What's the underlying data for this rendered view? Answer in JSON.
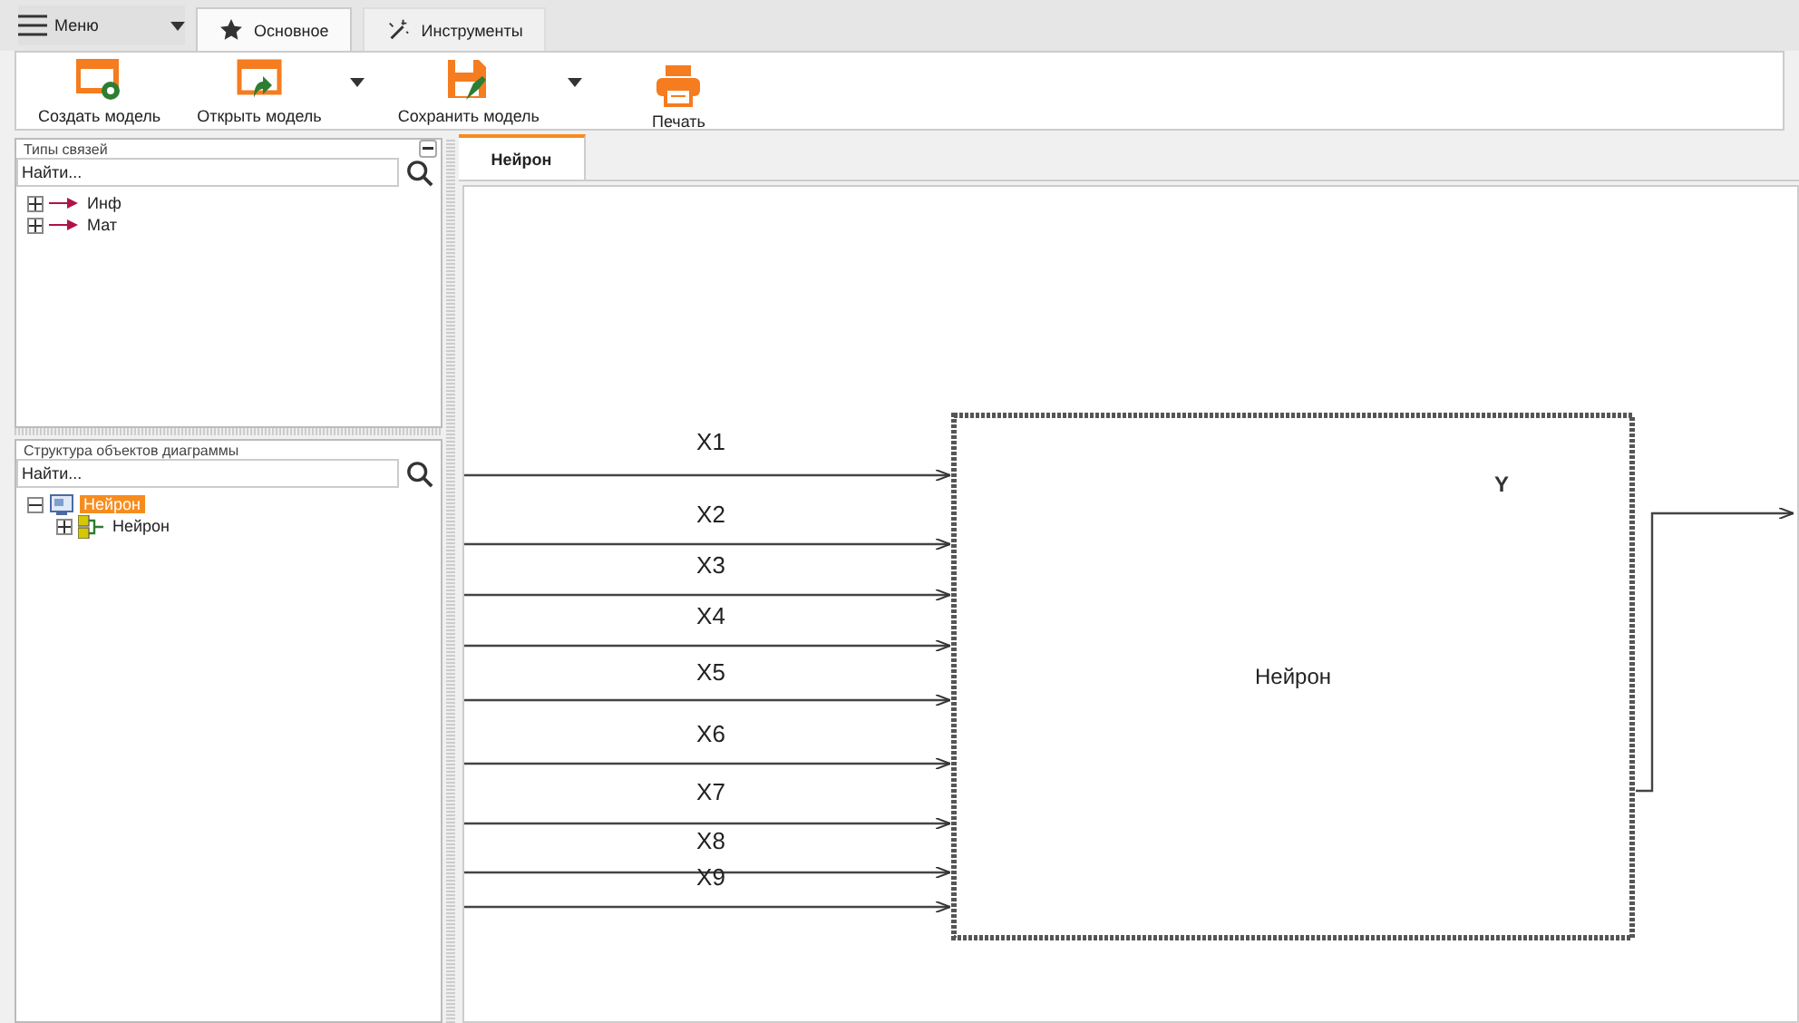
{
  "menu": {
    "label": "Меню"
  },
  "tabs": [
    {
      "label": "Основное",
      "kind": "star",
      "selected": true
    },
    {
      "label": "Инструменты",
      "kind": "wand",
      "selected": false
    }
  ],
  "ribbon": {
    "buttons": [
      {
        "label": "Создать модель",
        "kind": "create",
        "dropdown": false
      },
      {
        "label": "Открыть модель",
        "kind": "open",
        "dropdown": true
      },
      {
        "label": "Сохранить модель",
        "kind": "save",
        "dropdown": true
      },
      {
        "label": "Печать",
        "kind": "print",
        "dropdown": false
      }
    ]
  },
  "link_types": {
    "title": "Типы связей",
    "search": {
      "placeholder": "Найти..."
    },
    "items": [
      {
        "label": "Инф",
        "expanded": false
      },
      {
        "label": "Мат",
        "expanded": false
      }
    ]
  },
  "structure": {
    "title": "Структура объектов диаграммы",
    "search": {
      "placeholder": "Найти..."
    },
    "items": [
      {
        "label": "Нейрон",
        "expanded": true,
        "selected": true,
        "children": [
          {
            "label": "Нейрон",
            "expanded": false,
            "selected": false
          }
        ]
      }
    ]
  },
  "document_tabs": [
    {
      "label": "Нейрон",
      "selected": true
    }
  ],
  "diagram": {
    "node": "Нейрон",
    "output": "Y",
    "inputs": [
      "X1",
      "X2",
      "X3",
      "X4",
      "X5",
      "X6",
      "X7",
      "X8",
      "X9"
    ]
  }
}
